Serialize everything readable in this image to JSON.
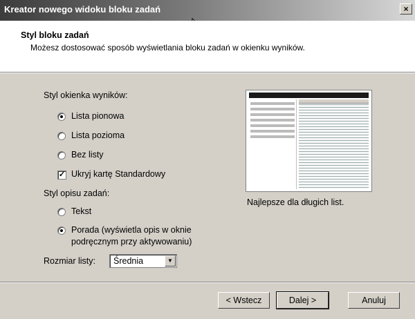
{
  "window": {
    "title": "Kreator nowego widoku bloku zadań",
    "close": "×"
  },
  "header": {
    "title": "Styl bloku zadań",
    "subtitle": "Możesz dostosować sposób wyświetlania bloku zadań w okienku wyników."
  },
  "results_style": {
    "label": "Styl okienka wyników:",
    "options": [
      {
        "label": "Lista pionowa",
        "selected": true
      },
      {
        "label": "Lista pozioma",
        "selected": false
      },
      {
        "label": "Bez listy",
        "selected": false
      }
    ],
    "checkbox": {
      "label": "Ukryj kartę Standardowy",
      "checked": true
    }
  },
  "desc_style": {
    "label": "Styl opisu zadań:",
    "options": [
      {
        "label": "Tekst",
        "selected": false
      },
      {
        "label_line1": "Porada (wyświetla opis w oknie",
        "label_line2": "podręcznym przy aktywowaniu)",
        "selected": true
      }
    ]
  },
  "list_size": {
    "label": "Rozmiar listy:",
    "value": "Średnia"
  },
  "preview": {
    "caption": "Najlepsze dla długich list."
  },
  "buttons": {
    "back": "< Wstecz",
    "next": "Dalej >",
    "cancel": "Anuluj"
  },
  "icons": [
    "close-icon",
    "mouse-cursor-icon",
    "dropdown-arrow-icon"
  ]
}
